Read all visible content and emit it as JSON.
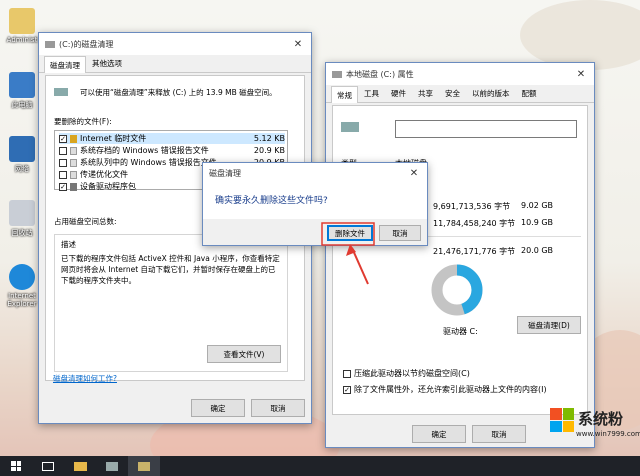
{
  "desktop": {
    "icons": [
      {
        "label": "Administ"
      },
      {
        "label": "此电脑"
      },
      {
        "label": "网络"
      },
      {
        "label": "回收站"
      },
      {
        "label": "Internet Explorer"
      }
    ]
  },
  "cleanup": {
    "title": "(C:)的磁盘清理",
    "tabs": [
      "磁盘清理",
      "其他选项"
    ],
    "intro": "可以使用“磁盘清理”来释放 (C:) 上的 13.9 MB 磁盘空间。",
    "files_label": "要删除的文件(F):",
    "files": [
      {
        "name": "Internet 临时文件",
        "size": "5.12 KB",
        "checked": true
      },
      {
        "name": "系统存档的 Windows 错误报告文件",
        "size": "20.9 KB",
        "checked": false
      },
      {
        "name": "系统队列中的 Windows 错误报告文件",
        "size": "20.9 KB",
        "checked": false
      },
      {
        "name": "传递优化文件",
        "size": "",
        "checked": false
      },
      {
        "name": "设备驱动程序包",
        "size": "",
        "checked": true
      }
    ],
    "gain_label": "占用磁盘空间总数:",
    "desc_label": "描述",
    "desc_text": "已下载的程序文件包括 ActiveX 控件和 Java 小程序，你查看特定网页时将会从 Internet 自动下载它们，并暂时保存在硬盘上的已下载的程序文件夹中。",
    "view_files": "查看文件(V)",
    "help_link": "磁盘清理如何工作?",
    "ok": "确定",
    "cancel": "取消"
  },
  "props": {
    "title": "本地磁盘 (C:) 属性",
    "tabs": [
      "常规",
      "工具",
      "硬件",
      "共享",
      "安全",
      "以前的版本",
      "配额"
    ],
    "type_label": "类型:",
    "type_value": "本地磁盘",
    "used_bytes": "9,691,713,536 字节",
    "used_gb": "9.02 GB",
    "free_bytes": "11,784,458,240 字节",
    "free_gb": "10.9 GB",
    "cap_bytes": "21,476,171,776 字节",
    "cap_gb": "20.0 GB",
    "drive_label": "驱动器 C:",
    "cleanup_btn": "磁盘清理(D)",
    "compress": "压缩此驱动器以节约磁盘空间(C)",
    "index": "除了文件属性外，还允许索引此驱动器上文件的内容(I)",
    "ok": "确定",
    "cancel": "取消",
    "used_fraction": 0.45,
    "colors": {
      "used": "#2aa7e0",
      "free": "#c4c4c4"
    }
  },
  "confirm": {
    "title": "磁盘清理",
    "message": "确实要永久删除这些文件吗?",
    "delete": "删除文件",
    "cancel": "取消"
  },
  "watermark": {
    "brand": "系统粉",
    "url": "www.win7999.com"
  },
  "colors": {
    "accent": "#0078d7",
    "arrow": "#e03a30"
  }
}
